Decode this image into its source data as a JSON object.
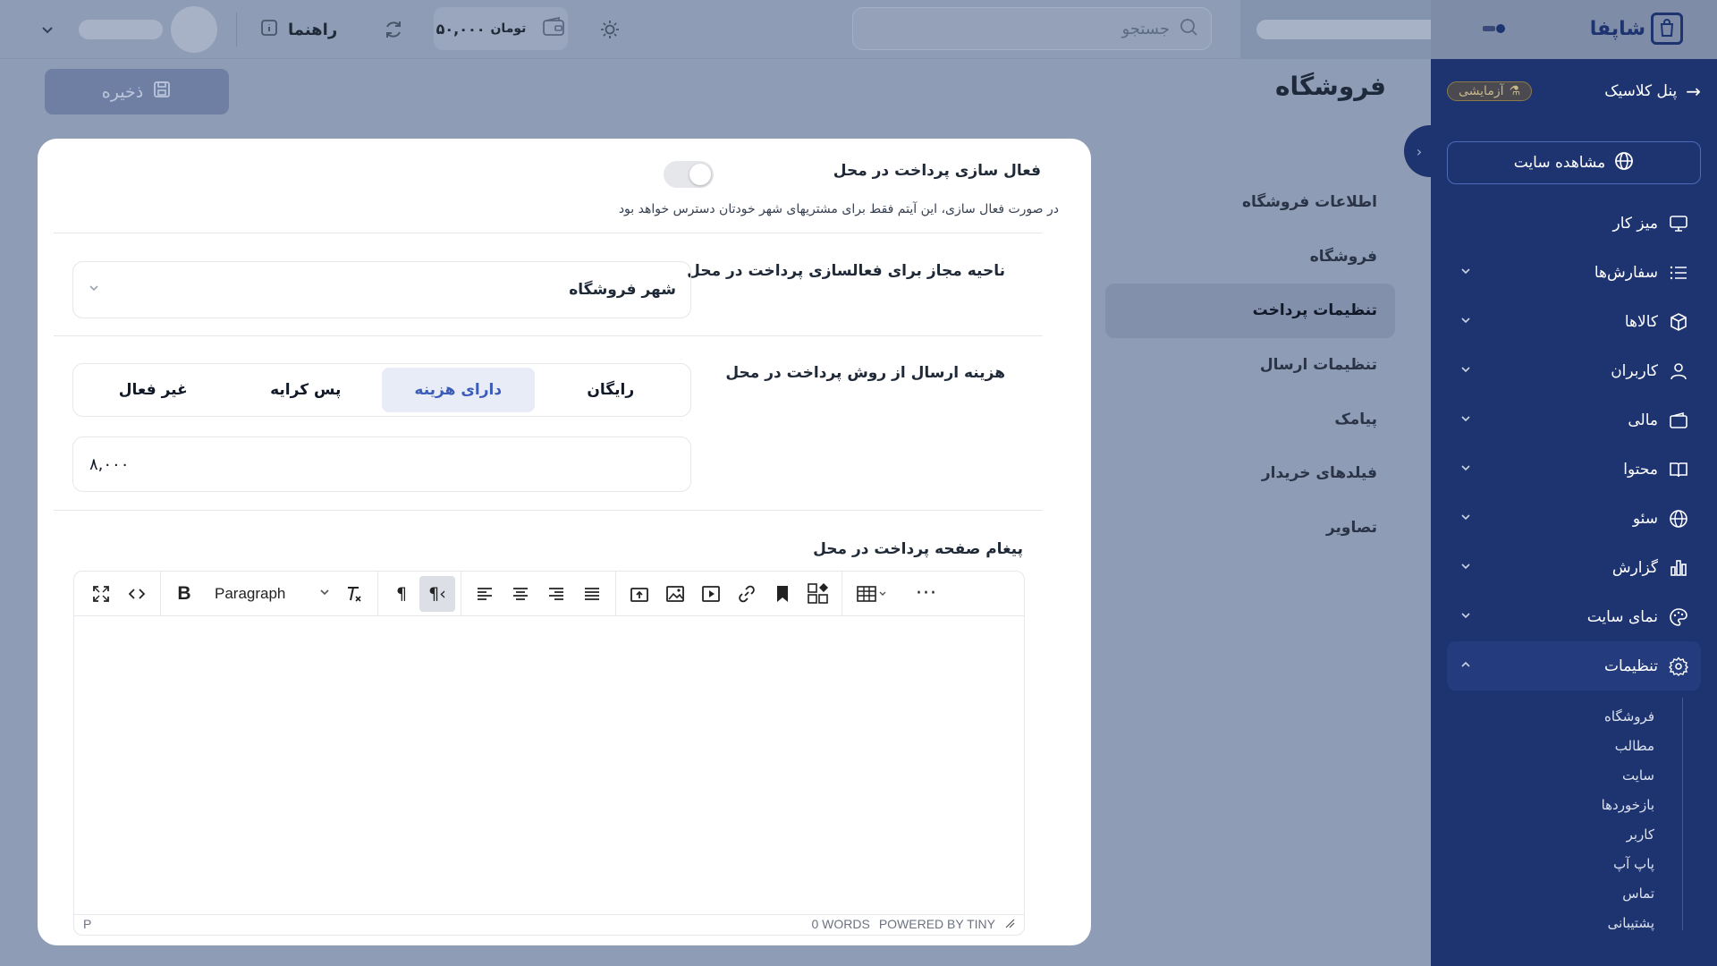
{
  "brand": {
    "name": "شاپفا"
  },
  "topbar": {
    "search_placeholder": "جستجو",
    "wallet_amount": "۵۰,۰۰۰",
    "wallet_unit": "تومان",
    "guide_label": "راهنما"
  },
  "sidebar": {
    "classic_panel": "پنل کلاسیک",
    "test_badge": "آزمایشی",
    "view_site": "مشاهده سایت",
    "items": [
      {
        "label": "میز کار",
        "icon": "monitor-icon",
        "expandable": false
      },
      {
        "label": "سفارش‌ها",
        "icon": "list-icon",
        "expandable": true
      },
      {
        "label": "کالاها",
        "icon": "box-icon",
        "expandable": true
      },
      {
        "label": "کاربران",
        "icon": "user-icon",
        "expandable": true
      },
      {
        "label": "مالی",
        "icon": "wallet-icon",
        "expandable": true
      },
      {
        "label": "محتوا",
        "icon": "book-icon",
        "expandable": true
      },
      {
        "label": "سئو",
        "icon": "globe-icon",
        "expandable": true
      },
      {
        "label": "گزارش",
        "icon": "chart-icon",
        "expandable": true
      },
      {
        "label": "نمای سایت",
        "icon": "palette-icon",
        "expandable": true
      },
      {
        "label": "تنظیمات",
        "icon": "gear-icon",
        "expandable": true
      }
    ],
    "subitems": [
      "فروشگاه",
      "مطالب",
      "سایت",
      "بازخوردها",
      "کاربر",
      "پاپ آپ",
      "تماس",
      "پشتیبانی"
    ]
  },
  "page": {
    "title": "فروشگاه",
    "save_label": "ذخیره"
  },
  "settings_nav": [
    "اطلاعات فروشگاه",
    "فروشگاه",
    "تنظیمات پرداخت",
    "تنظیمات ارسال",
    "پیامک",
    "فیلدهای خریدار",
    "تصاویر"
  ],
  "settings_nav_active": "تنظیمات پرداخت",
  "modal": {
    "cod_enable_label": "فعال سازی پرداخت در محل",
    "cod_enable_hint": "در صورت فعال سازی، این آیتم فقط برای مشتریهای شهر خودتان دسترس خواهد بود",
    "cod_enabled": true,
    "region_label": "ناحیه مجاز برای فعالسازی پرداخت در محل",
    "region_value": "شهر فروشگاه",
    "shipping_cost_label": "هزینه ارسال از روش پرداخت در محل",
    "shipping_options": [
      "رایگان",
      "دارای هزینه",
      "پس کرایه",
      "غیر فعال"
    ],
    "shipping_selected": "دارای هزینه",
    "shipping_cost_value": "۸,۰۰۰",
    "message_label": "پیغام صفحه پرداخت در محل"
  },
  "editor": {
    "block_format": "Paragraph",
    "status_path": "P",
    "word_count": "0 WORDS",
    "powered_by": "POWERED BY TINY"
  }
}
